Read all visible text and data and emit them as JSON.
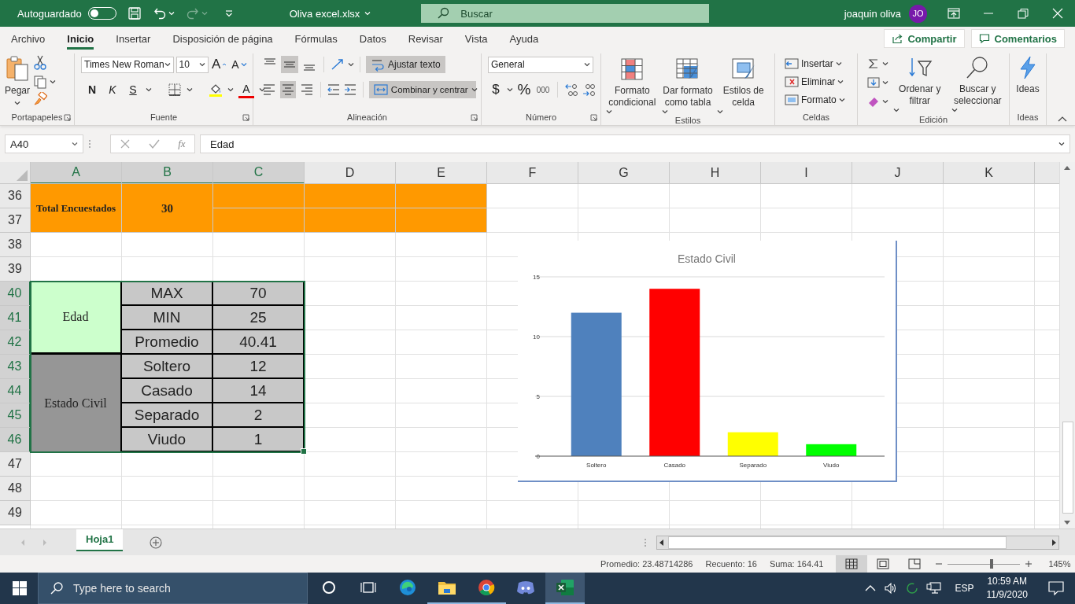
{
  "title_bar": {
    "autosave": {
      "label": "Autoguardado",
      "on": false
    },
    "redo_disabled": true,
    "file_name": "Oliva excel.xlsx",
    "search_placeholder": "Buscar",
    "user_name": "joaquin oliva",
    "user_initials": "JO"
  },
  "menu_tabs": [
    {
      "label": "Archivo",
      "selected": false
    },
    {
      "label": "Inicio",
      "selected": true
    },
    {
      "label": "Insertar",
      "selected": false
    },
    {
      "label": "Disposición de página",
      "selected": false
    },
    {
      "label": "Fórmulas",
      "selected": false
    },
    {
      "label": "Datos",
      "selected": false
    },
    {
      "label": "Revisar",
      "selected": false
    },
    {
      "label": "Vista",
      "selected": false
    },
    {
      "label": "Ayuda",
      "selected": false
    }
  ],
  "share_button": "Compartir",
  "comments_button": "Comentarios",
  "ribbon": {
    "clipboard": {
      "paste": "Pegar",
      "group": "Portapapeles"
    },
    "font": {
      "family": "Times New Roman",
      "size": "10",
      "grow": "A",
      "shrink": "A",
      "bold": "N",
      "italic": "K",
      "underline": "S",
      "color_letter": "A",
      "group": "Fuente"
    },
    "alignment": {
      "vertical": [
        {
          "selected": false
        },
        {
          "selected": true
        },
        {
          "selected": false
        }
      ],
      "horizontal": [
        {
          "selected": false
        },
        {
          "selected": true
        },
        {
          "selected": false
        }
      ],
      "wrap_text": {
        "label": "Ajustar texto",
        "on": true
      },
      "merge": {
        "label": "Combinar y centrar",
        "on": true
      },
      "group": "Alineación"
    },
    "number": {
      "format": "General",
      "currency": "$",
      "percent": "%",
      "thousands": "000",
      "group": "Número"
    },
    "styles": {
      "buttons": [
        {
          "kind": "conditional",
          "label": "Formato condicional"
        },
        {
          "kind": "table",
          "label": "Dar formato como tabla"
        },
        {
          "kind": "cell",
          "label": "Estilos de celda"
        }
      ],
      "group": "Estilos"
    },
    "cells": {
      "buttons": [
        {
          "kind": "insert",
          "label": "Insertar"
        },
        {
          "kind": "delete",
          "label": "Eliminar"
        },
        {
          "kind": "format",
          "label": "Formato"
        }
      ],
      "group": "Celdas"
    },
    "editing": {
      "buttons": [
        {
          "kind": "sort",
          "label": "Ordenar y filtrar"
        },
        {
          "kind": "find",
          "label": "Buscar y seleccionar"
        }
      ],
      "group": "Edición"
    },
    "ideas": {
      "label": "Ideas",
      "group": "Ideas"
    }
  },
  "formula_bar": {
    "name_box": "A40",
    "function_symbol": "fx",
    "value": "Edad"
  },
  "sheet": {
    "columns": [
      {
        "label": "A",
        "selected": true
      },
      {
        "label": "B",
        "selected": true
      },
      {
        "label": "C",
        "selected": true
      },
      {
        "label": "D",
        "selected": false
      },
      {
        "label": "E",
        "selected": false
      },
      {
        "label": "F",
        "selected": false
      },
      {
        "label": "G",
        "selected": false
      },
      {
        "label": "H",
        "selected": false
      },
      {
        "label": "I",
        "selected": false
      },
      {
        "label": "J",
        "selected": false
      },
      {
        "label": "K",
        "selected": false
      }
    ],
    "rows": [
      {
        "label": "36",
        "selected": false
      },
      {
        "label": "37",
        "selected": false
      },
      {
        "label": "38",
        "selected": false
      },
      {
        "label": "39",
        "selected": false
      },
      {
        "label": "40",
        "selected": true
      },
      {
        "label": "41",
        "selected": true
      },
      {
        "label": "42",
        "selected": true
      },
      {
        "label": "43",
        "selected": true
      },
      {
        "label": "44",
        "selected": true
      },
      {
        "label": "45",
        "selected": true
      },
      {
        "label": "46",
        "selected": true
      },
      {
        "label": "47",
        "selected": false
      },
      {
        "label": "48",
        "selected": false
      },
      {
        "label": "49",
        "selected": false
      }
    ],
    "summary": {
      "label": "Total Encuestados",
      "value": "30"
    },
    "stats": [
      {
        "label": "Edad",
        "color": "#ccffcc",
        "items": [
          {
            "label": "MAX",
            "value": "70"
          },
          {
            "label": "MIN",
            "value": "25"
          },
          {
            "label": "Promedio",
            "value": "40.41"
          }
        ]
      },
      {
        "label": "Estado Civil",
        "color": "#969696",
        "items": [
          {
            "label": "Soltero",
            "value": "12"
          },
          {
            "label": "Casado",
            "value": "14"
          },
          {
            "label": "Separado",
            "value": "2"
          },
          {
            "label": "Viudo",
            "value": "1"
          }
        ]
      }
    ]
  },
  "chart": {
    "chart_data": {
      "type": "bar",
      "title": "Estado Civil",
      "categories": [
        "Soltero",
        "Casado",
        "Separado",
        "Viudo"
      ],
      "series": [
        {
          "values": [
            12,
            14,
            2,
            1
          ]
        }
      ],
      "ylim": [
        0,
        15
      ],
      "yticks": [
        0,
        5,
        10,
        15
      ]
    },
    "bars": [
      {
        "color": "#4f81bd"
      },
      {
        "color": "#ff0000"
      },
      {
        "color": "#ffff00"
      },
      {
        "color": "#00ff00"
      }
    ]
  },
  "sheet_tabs": [
    {
      "label": "Hoja1",
      "selected": true
    }
  ],
  "status_bar": {
    "average": "Promedio: 23.48714286",
    "count": "Recuento: 16",
    "sum": "Suma: 164.41",
    "views": [
      {
        "kind": "normal",
        "selected": true
      },
      {
        "kind": "page_layout",
        "selected": false
      },
      {
        "kind": "page_break",
        "selected": false
      }
    ],
    "zoom": {
      "level": 0.6,
      "label": "145%"
    }
  },
  "taskbar": {
    "search_placeholder": "Type here to search",
    "apps": [
      {
        "kind": "cortana",
        "running": false,
        "active": false
      },
      {
        "kind": "task_view",
        "running": false,
        "active": false
      },
      {
        "kind": "edge",
        "running": false,
        "active": false
      },
      {
        "kind": "explorer",
        "running": true,
        "active": false
      },
      {
        "kind": "chrome",
        "running": true,
        "active": false
      },
      {
        "kind": "discord",
        "running": false,
        "active": false
      },
      {
        "kind": "excel",
        "running": true,
        "active": true
      }
    ],
    "language": "ESP",
    "time": "10:59 AM",
    "date": "11/9/2020"
  }
}
